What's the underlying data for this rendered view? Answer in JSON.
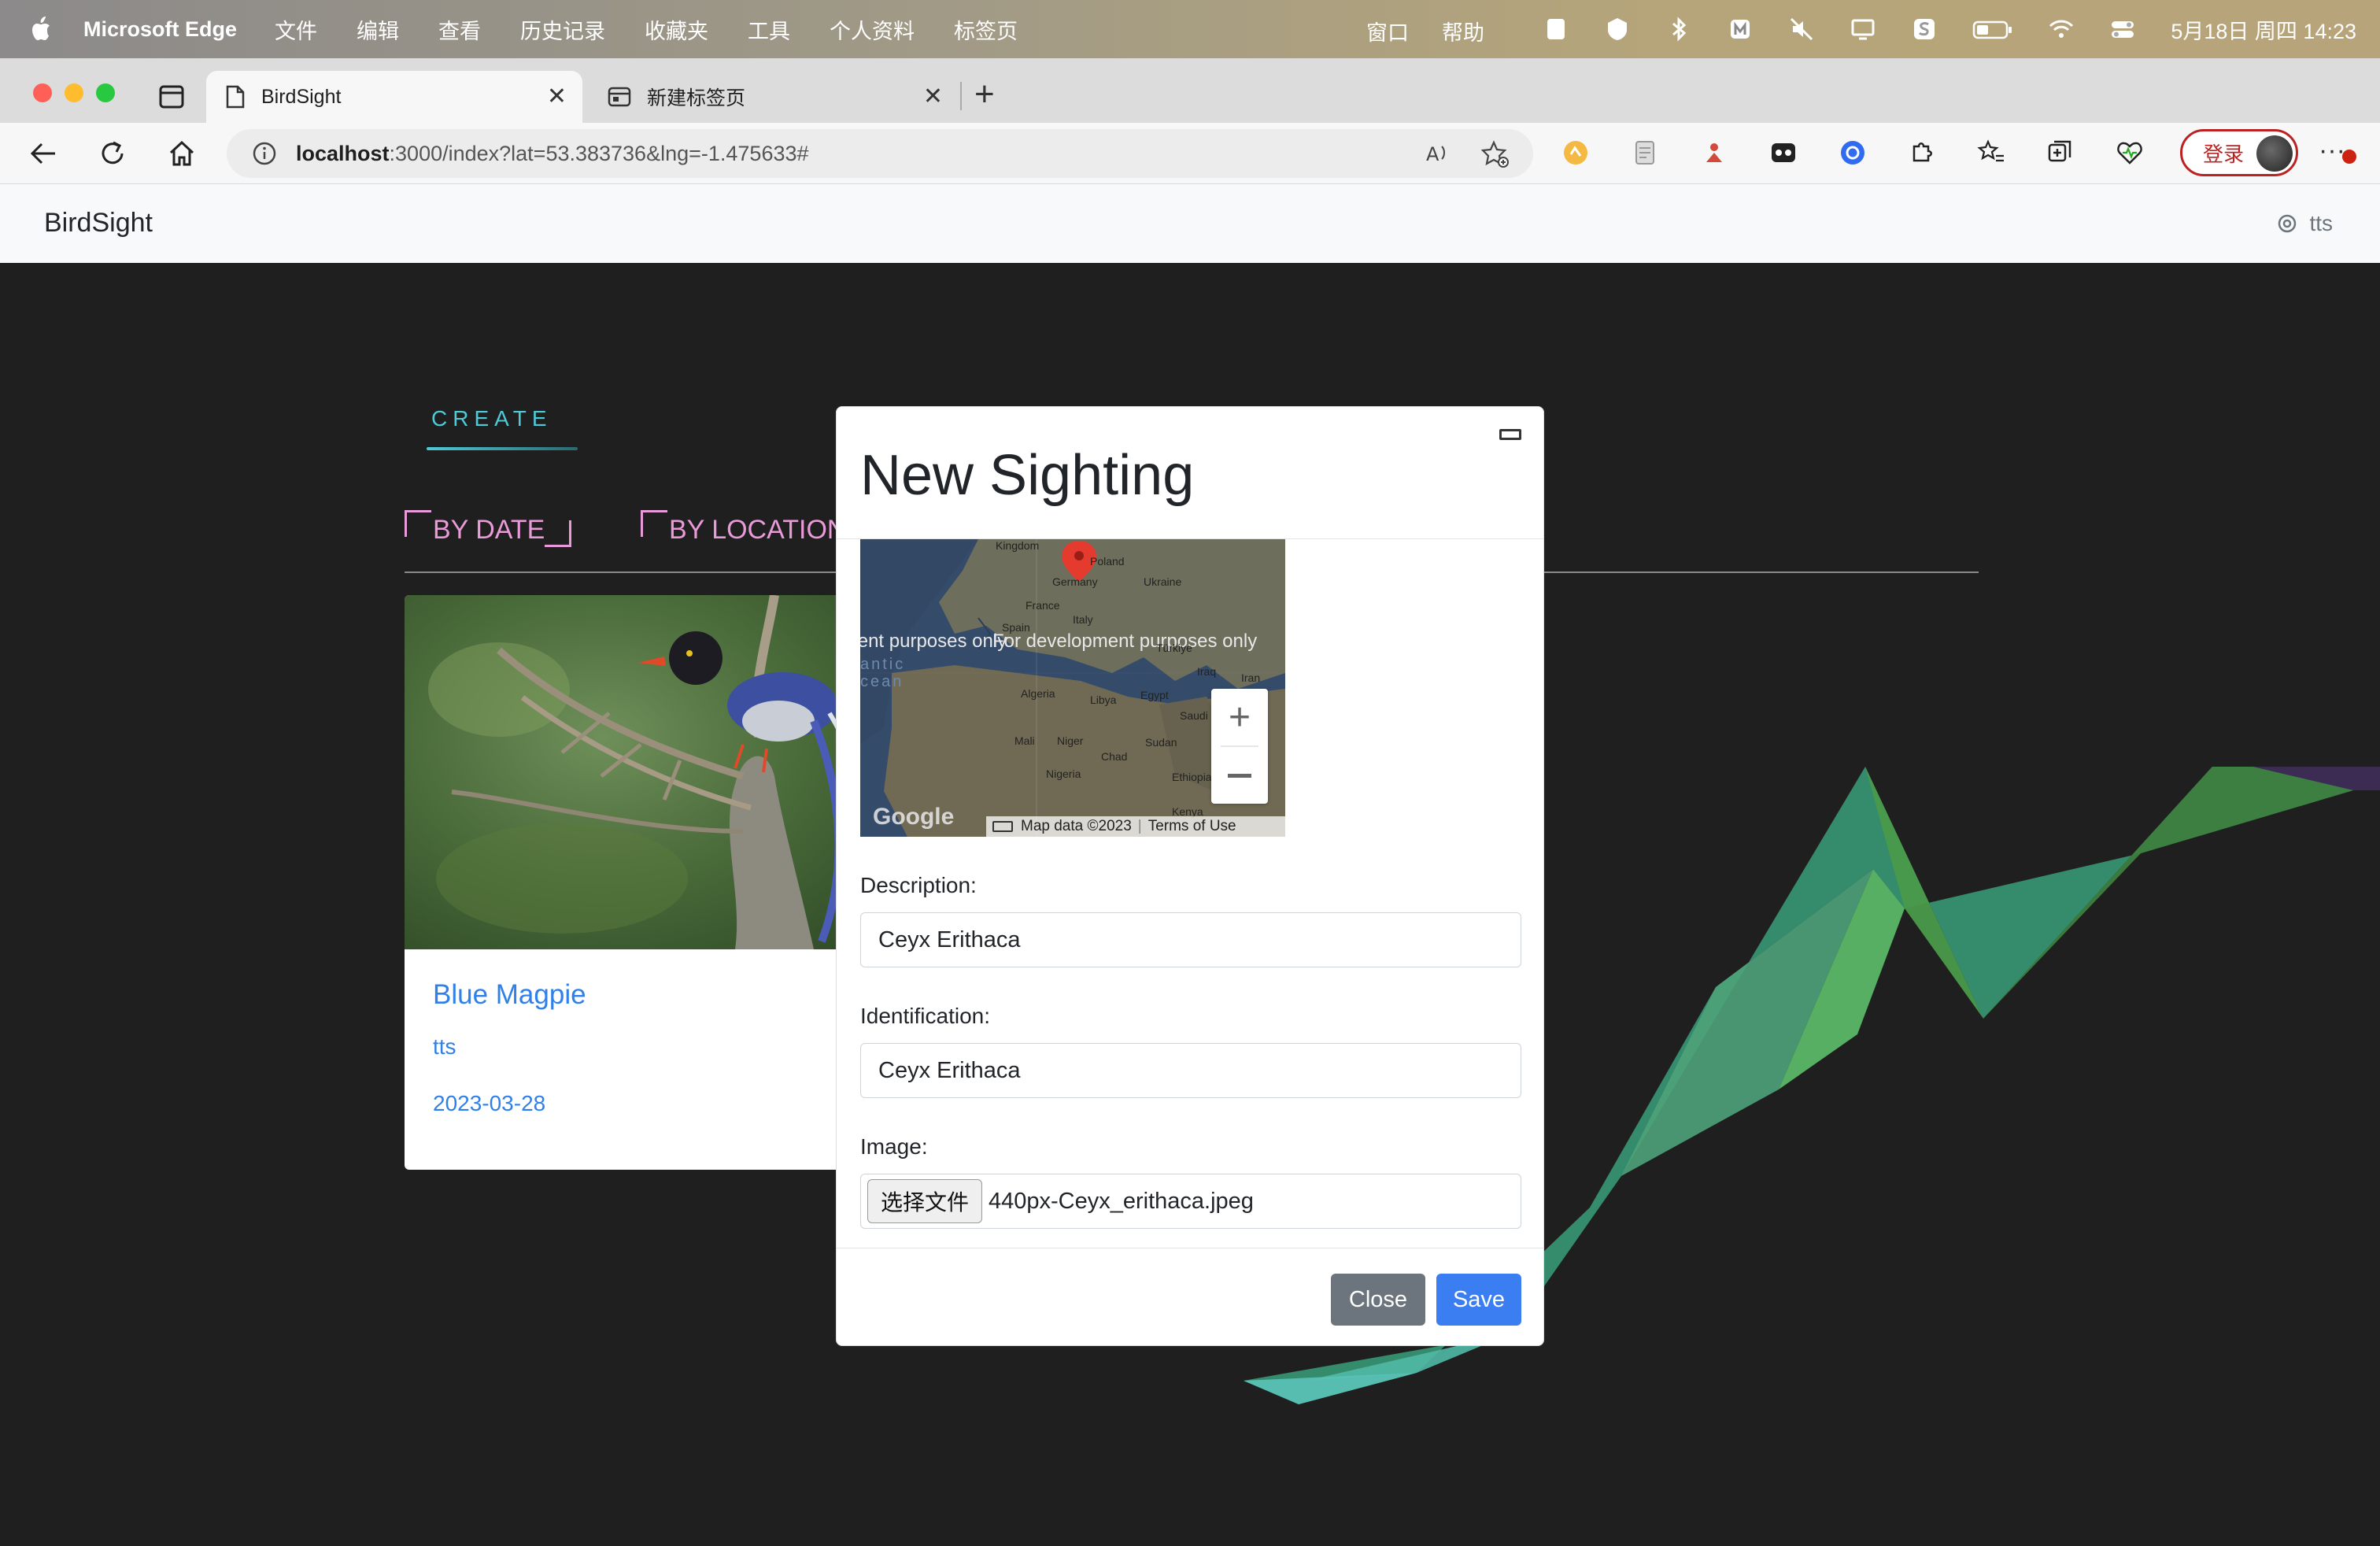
{
  "menubar": {
    "app_name": "Microsoft Edge",
    "menus": [
      "文件",
      "编辑",
      "查看",
      "历史记录",
      "收藏夹",
      "工具",
      "个人资料",
      "标签页"
    ],
    "right_menus": [
      "窗口",
      "帮助"
    ],
    "clock": "5月18日 周四  14:23"
  },
  "tabs": [
    {
      "title": "BirdSight",
      "active": true
    },
    {
      "title": "新建标签页",
      "active": false
    }
  ],
  "address_bar": {
    "host": "localhost",
    "path": ":3000/index?lat=53.383736&lng=-1.475633#"
  },
  "signin_label": "登录",
  "site": {
    "brand": "BirdSight",
    "user": "tts",
    "create_tab": "CREATE",
    "filters": [
      "BY DATE",
      "BY LOCATION"
    ]
  },
  "card": {
    "title": "Blue Magpie",
    "user": "tts",
    "date": "2023-03-28"
  },
  "modal": {
    "title": "New Sighting",
    "map": {
      "watermark": "For development purposes only",
      "attribution": "Map data ©2023",
      "terms": "Terms of Use",
      "google": "Google",
      "places": [
        "Kingdom",
        "Poland",
        "Germany",
        "Ukraine",
        "France",
        "Italy",
        "Spain",
        "Türkiye",
        "Algeria",
        "Libya",
        "Egypt",
        "Iraq",
        "Iran",
        "Saudi",
        "Mali",
        "Niger",
        "Chad",
        "Sudan",
        "Nigeria",
        "Ethiopia",
        "Kenya",
        "antic",
        "cean"
      ]
    },
    "description_label": "Description:",
    "description_value": "Ceyx Erithaca",
    "identification_label": "Identification:",
    "identification_value": "Ceyx Erithaca",
    "image_label": "Image:",
    "file_button": "选择文件",
    "file_name": "440px-Ceyx_erithaca.jpeg",
    "close_label": "Close",
    "save_label": "Save"
  },
  "colors": {
    "accent_cyan": "#4ec9d8",
    "filter_pink": "#e99ad8",
    "link_blue": "#2f80e8",
    "save_blue": "#3b7ef2",
    "close_gray": "#6c757d"
  }
}
